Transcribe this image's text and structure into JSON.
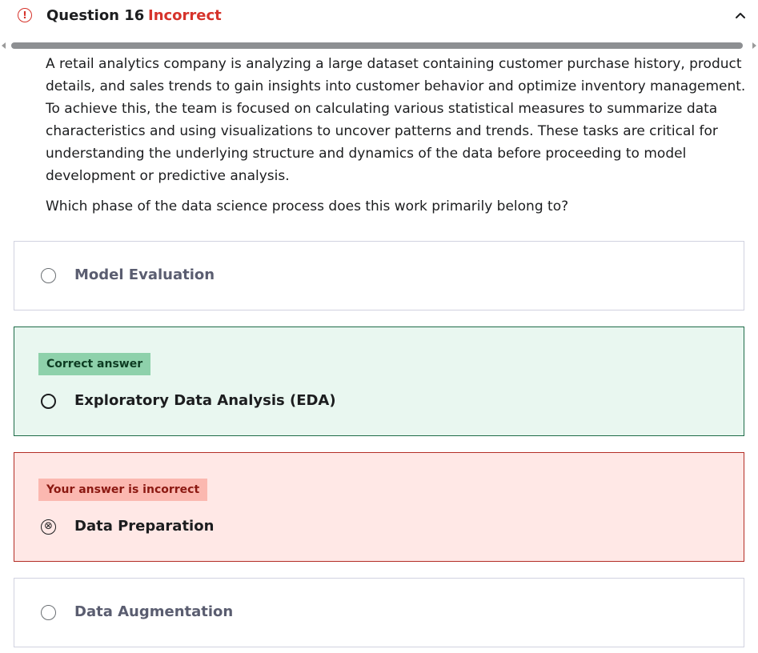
{
  "header": {
    "warn_icon_glyph": "!",
    "question_title": "Question 16",
    "status": "Incorrect",
    "status_color": "#d6332b",
    "collapse_icon": "chevron-up-icon"
  },
  "question": {
    "text": "A retail analytics company is analyzing a large dataset containing customer purchase history, product details, and sales trends to gain insights into customer behavior and optimize inventory management. To achieve this, the team is focused on calculating various statistical measures to summarize data characteristics and using visualizations to uncover patterns and trends. These tasks are critical for understanding the underlying structure and dynamics of the data before proceeding to model development or predictive analysis.",
    "prompt": "Which phase of the data science process does this work primarily belong to?"
  },
  "options": [
    {
      "label": "Model Evaluation",
      "state": "default"
    },
    {
      "label": "Exploratory Data Analysis (EDA)",
      "state": "correct",
      "badge": "Correct answer"
    },
    {
      "label": "Data Preparation",
      "state": "incorrect",
      "badge": "Your answer is incorrect",
      "marker": "⊗"
    },
    {
      "label": "Data Augmentation",
      "state": "default"
    }
  ],
  "colors": {
    "correct_bg": "#e9f7f0",
    "correct_border": "#1e6b48",
    "correct_badge": "#8ed1ab",
    "wrong_bg": "#ffe8e6",
    "wrong_border": "#b32d26",
    "wrong_badge": "#fbb8b0"
  }
}
